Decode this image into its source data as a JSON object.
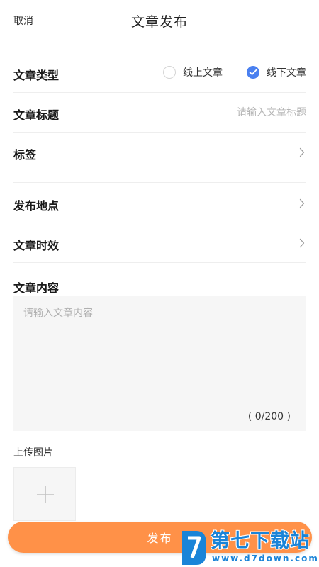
{
  "header": {
    "cancel_label": "取消",
    "title": "文章发布"
  },
  "form": {
    "article_type": {
      "label": "文章类型",
      "options": [
        {
          "label": "线上文章",
          "selected": false
        },
        {
          "label": "线下文章",
          "selected": true
        }
      ]
    },
    "article_title": {
      "label": "文章标题",
      "value": "",
      "placeholder": "请输入文章标题"
    },
    "tags": {
      "label": "标签"
    },
    "location": {
      "label": "发布地点"
    },
    "timeliness": {
      "label": "文章时效"
    },
    "content": {
      "label": "文章内容",
      "value": "",
      "placeholder": "请输入文章内容",
      "char_count": "( 0/200 )"
    },
    "upload": {
      "label": "上传图片"
    }
  },
  "publish_label": "发布",
  "watermark": {
    "title": "第七下载站",
    "url": "www.d7down.com"
  },
  "colors": {
    "accent_blue": "#4a80f0",
    "publish_orange": "#ff9148",
    "watermark_blue": "#1a84d8"
  }
}
